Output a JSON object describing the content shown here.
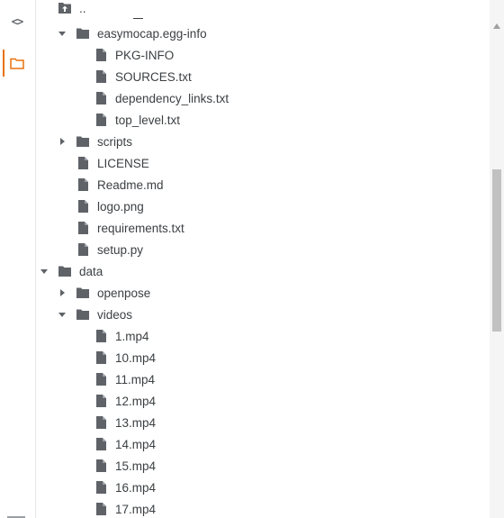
{
  "tree": {
    "up_label": "..",
    "items": [
      {
        "label": "easymocap.egg-info"
      },
      {
        "label": "PKG-INFO"
      },
      {
        "label": "SOURCES.txt"
      },
      {
        "label": "dependency_links.txt"
      },
      {
        "label": "top_level.txt"
      },
      {
        "label": "scripts"
      },
      {
        "label": "LICENSE"
      },
      {
        "label": "Readme.md"
      },
      {
        "label": "logo.png"
      },
      {
        "label": "requirements.txt"
      },
      {
        "label": "setup.py"
      },
      {
        "label": "data"
      },
      {
        "label": "openpose"
      },
      {
        "label": "videos"
      },
      {
        "label": "1.mp4"
      },
      {
        "label": "10.mp4"
      },
      {
        "label": "11.mp4"
      },
      {
        "label": "12.mp4"
      },
      {
        "label": "13.mp4"
      },
      {
        "label": "14.mp4"
      },
      {
        "label": "15.mp4"
      },
      {
        "label": "16.mp4"
      },
      {
        "label": "17.mp4"
      }
    ]
  },
  "icons": {
    "code": "<>",
    "folder": "folder-icon",
    "file": "file-icon"
  },
  "colors": {
    "accent": "#e8710a",
    "icon": "#5f6368",
    "text": "#3c4043"
  }
}
